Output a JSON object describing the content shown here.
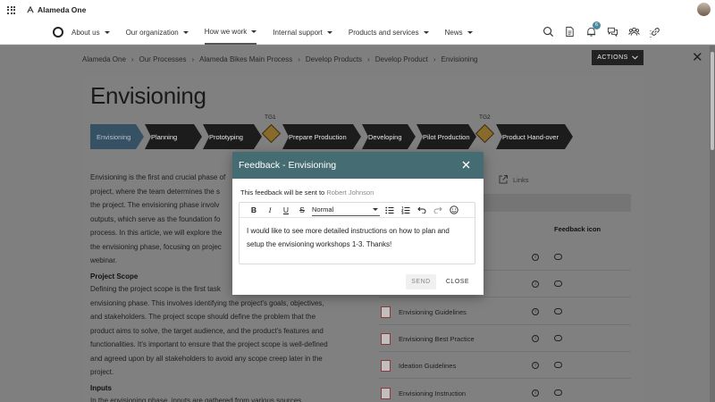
{
  "app": {
    "name": "Alameda One"
  },
  "nav": {
    "items": [
      {
        "label": "About us"
      },
      {
        "label": "Our organization"
      },
      {
        "label": "How we work"
      },
      {
        "label": "Internal support"
      },
      {
        "label": "Products and services"
      },
      {
        "label": "News"
      }
    ],
    "active_index": 2,
    "notification_count": "6"
  },
  "breadcrumb": [
    "Alameda One",
    "Our Processes",
    "Alameda Bikes Main Process",
    "Develop Products",
    "Develop Product",
    "Envisioning"
  ],
  "actions_label": "ACTIONS",
  "page": {
    "title": "Envisioning",
    "steps": [
      "Envisioning",
      "Planning",
      "Prototyping",
      "Prepare Production",
      "Developing",
      "Pilot Production",
      "Product Hand-over"
    ],
    "gates": [
      "TG1",
      "TG2"
    ],
    "paragraph1": [
      "Envisioning is the first and crucial phase of",
      "project, where the team determines the s",
      "the project. The envisioning phase involv",
      "outputs, which serve as the foundation fo",
      "process. In this article, we will explore the",
      "the envisioning phase, focusing on projec",
      "webinar."
    ],
    "heading_scope": "Project Scope",
    "paragraph2": [
      "Defining the project scope is the first task",
      "envisioning phase. This involves identifying the project's goals, objectives,",
      "and stakeholders. The project scope should define the problem that the",
      "product aims to solve, the target audience, and the product's features and",
      "functionalities. It's important to ensure that the project scope is well-defined",
      "and agreed upon by all stakeholders to avoid any scope creep later in the",
      "project."
    ],
    "heading_inputs": "Inputs",
    "paragraph3": "In the envisioning phase, inputs are gathered from various sources",
    "links_tab": "Links",
    "feedback_icon_header": "Feedback icon",
    "documents": [
      {
        "name": ""
      },
      {
        "name": ""
      },
      {
        "name": "Envisioning Guidelines"
      },
      {
        "name": "Envisioning Best Practice"
      },
      {
        "name": "Ideation Guidelines"
      },
      {
        "name": "Envisioning Instruction"
      }
    ]
  },
  "modal": {
    "title": "Feedback - Envisioning",
    "recipient_prefix": "This feedback will be sent to",
    "recipient_name": "Robert Johnson",
    "format_select": "Normal",
    "message": "I would like to see more detailed instructions on how to plan and setup the envisioning workshops 1-3. Thanks!",
    "send_label": "SEND",
    "close_label": "CLOSE"
  },
  "colors": {
    "modal_header": "#466c73",
    "accent": "#4a8a9b"
  }
}
